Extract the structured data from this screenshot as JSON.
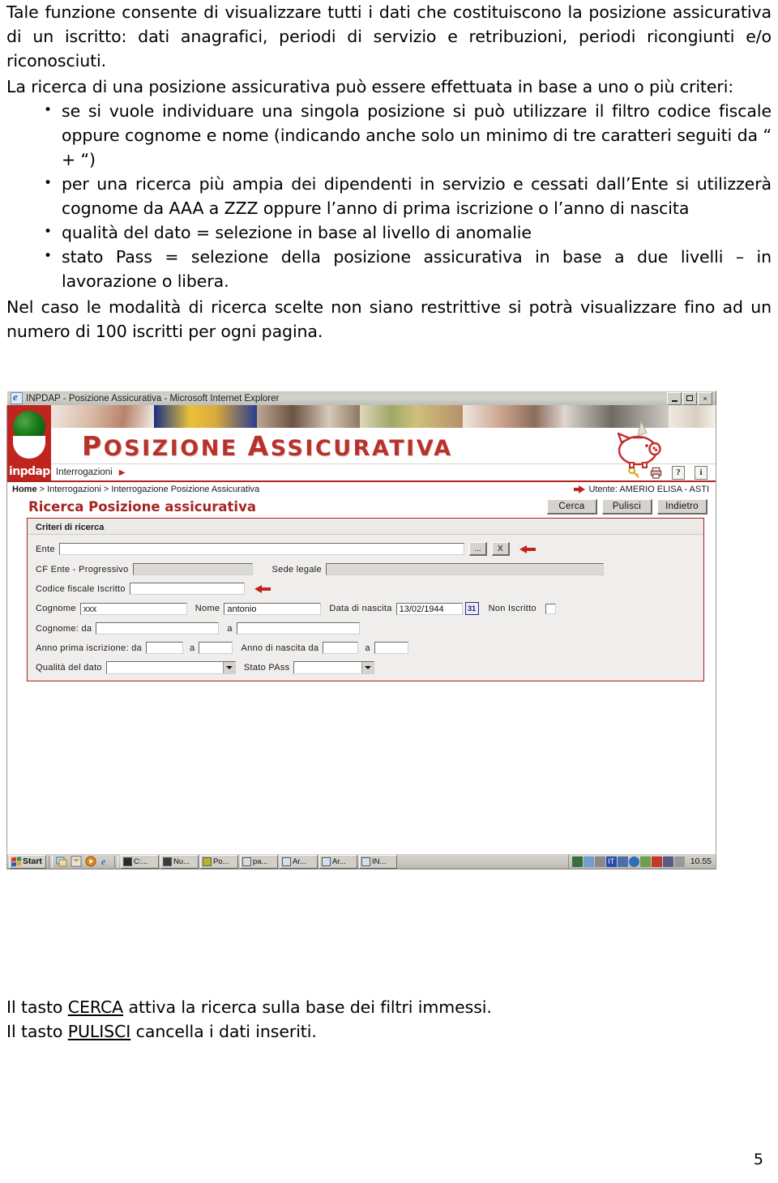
{
  "document": {
    "intro_paragraph": "Tale funzione consente di visualizzare tutti i dati che costituiscono la posizione assicurativa di un iscritto: dati anagrafici, periodi di servizio e retribuzioni, periodi ricongiunti e/o riconosciuti.",
    "criteria_lead": "La ricerca di una posizione assicurativa può essere effettuata in base a uno o più criteri:",
    "bullets": [
      "se si vuole individuare una singola posizione si può utilizzare il filtro codice fiscale oppure  cognome  e  nome (indicando anche solo un minimo di tre caratteri  seguiti da “ + “)",
      "per una ricerca più ampia dei dipendenti in servizio e cessati dall’Ente si utilizzerà cognome da AAA a  ZZZ oppure l’anno di prima iscrizione o l’anno di nascita",
      "qualità del dato = selezione in base al livello di anomalie",
      "stato Pass = selezione della posizione assicurativa in base a due livelli – in lavorazione o libera."
    ],
    "closing_paragraph": "Nel caso le modalità di ricerca scelte non siano restrittive si potrà visualizzare fino ad un numero di 100  iscritti per ogni pagina.",
    "footer_line1_prefix": "Il tasto ",
    "footer_line1_key": "CERCA",
    "footer_line1_suffix": " attiva la ricerca sulla base dei filtri immessi.",
    "footer_line2_prefix": "Il tasto ",
    "footer_line2_key": "PULISCI",
    "footer_line2_suffix": " cancella i dati inseriti.",
    "page_number": "5"
  },
  "browser": {
    "window_title": "INPDAP - Posizione Assicurativa - Microsoft Internet Explorer",
    "minimize_label": "Minimize",
    "maximize_label": "Maximize",
    "close_label": "×"
  },
  "app": {
    "logo_wordmark": "inpdap",
    "banner_title_lead": "P",
    "banner_title_rest": "OSIZIONE ",
    "banner_title_second_lead": "A",
    "banner_title_second_rest": "SSICURATIVA",
    "menu": {
      "label": "Interrogazioni",
      "caret": "▶"
    },
    "toolbar_icons": [
      {
        "name": "key-icon",
        "label": "Chiave"
      },
      {
        "name": "printer-icon",
        "label": "Stampa"
      },
      {
        "name": "help-icon",
        "label": "?"
      },
      {
        "name": "info-icon",
        "label": "i"
      }
    ],
    "breadcrumb": {
      "home": "Home",
      "sep1": " > ",
      "level2": "Interrogazioni",
      "sep2": " > ",
      "level3": "Interrogazione Posizione Assicurativa"
    },
    "user": "Utente: AMERIO ELISA - ASTI",
    "page_title": "Ricerca Posizione assicurativa",
    "buttons": {
      "search": "Cerca",
      "clear": "Pulisci",
      "back": "Indietro"
    }
  },
  "form": {
    "legend": "Criteri di ricerca",
    "ente": {
      "label": "Ente",
      "value": "",
      "browse_button": "...",
      "clear_button": "X"
    },
    "cf_ente": {
      "label": "CF Ente - Progressivo",
      "value": ""
    },
    "sede_legale": {
      "label": "Sede legale",
      "value": ""
    },
    "codice_fiscale": {
      "label": "Codice fiscale Iscritto",
      "value": ""
    },
    "cognome": {
      "label": "Cognome",
      "value": "xxx"
    },
    "nome": {
      "label": "Nome",
      "value": "antonio"
    },
    "data_nascita": {
      "label": "Data di nascita",
      "value": "13/02/1944",
      "calendar_button": "31"
    },
    "non_iscritto": {
      "label": "Non Iscritto",
      "checked": false
    },
    "cognome_range": {
      "label": "Cognome: da",
      "from": "",
      "to_label": "a",
      "to": ""
    },
    "anno_iscrizione": {
      "label": "Anno prima iscrizione: da",
      "from": "",
      "to_label": "a",
      "to": ""
    },
    "anno_nascita": {
      "label": "Anno di nascita da",
      "from": "",
      "to_label": "a",
      "to": ""
    },
    "qualita_dato": {
      "label": "Qualità del dato",
      "value": ""
    },
    "stato_pass": {
      "label": "Stato PAss",
      "value": ""
    }
  },
  "taskbar": {
    "start": "Start",
    "quick_launch": [
      {
        "name": "show-desktop-icon"
      },
      {
        "name": "outlook-icon"
      },
      {
        "name": "media-player-icon"
      },
      {
        "name": "internet-explorer-icon"
      }
    ],
    "tasks": [
      {
        "name": "task-c",
        "label": "C:..."
      },
      {
        "name": "task-nu",
        "label": "Nu..."
      },
      {
        "name": "task-po",
        "label": "Po..."
      },
      {
        "name": "task-pa",
        "label": "pa..."
      },
      {
        "name": "task-ar1",
        "label": "Ar..."
      },
      {
        "name": "task-ar2",
        "label": "Ar..."
      },
      {
        "name": "task-in",
        "label": "IN..."
      }
    ],
    "tray_language": "IT",
    "clock": "10.55"
  }
}
